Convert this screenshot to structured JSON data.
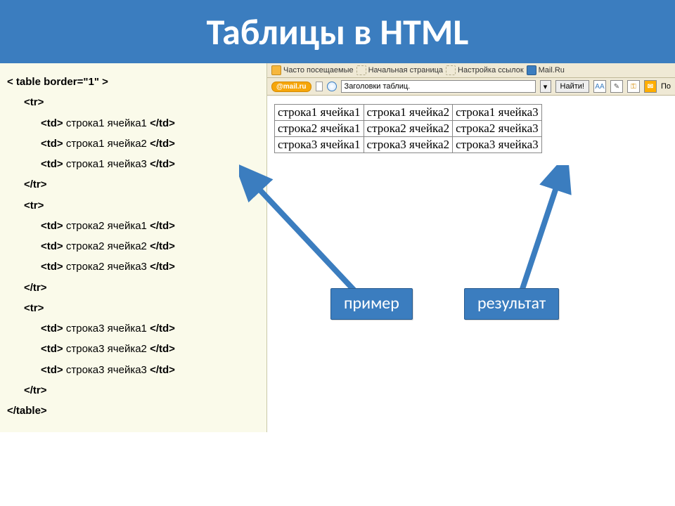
{
  "title": "Таблицы в HTML",
  "code": {
    "open_table": "< table border=\"1\" >",
    "tr_open": "<tr>",
    "tr_close": "</tr>",
    "close_table": "</table>",
    "cells": {
      "r1c1": "<td> строка1 ячейка1 </td>",
      "r1c2": "<td> строка1 ячейка2 </td>",
      "r1c3": "<td> строка1 ячейка3 </td>",
      "r2c1": "<td> строка2 ячейка1 </td>",
      "r2c2": "<td> строка2 ячейка2 </td>",
      "r2c3": "<td> строка2 ячейка3 </td>",
      "r3c1": "<td> строка3 ячейка1 </td>",
      "r3c2": "<td> строка3 ячейка2 </td>",
      "r3c3": "<td> строка3 ячейка3 </td>"
    }
  },
  "browser_links": {
    "frequent": "Часто посещаемые",
    "home": "Начальная страница",
    "links_setup": "Настройка ссылок",
    "mailru": "Mail.Ru"
  },
  "search": {
    "logo": "@mail.ru",
    "query": "Заголовки таблиц.",
    "find": "Найти!",
    "aa": "AA",
    "po": "По"
  },
  "result_cells": {
    "r1c1": "строка1 ячейка1",
    "r1c2": "строка1 ячейка2",
    "r1c3": "строка1 ячейка3",
    "r2c1": "строка2 ячейка1",
    "r2c2": "строка2 ячейка2",
    "r2c3": "строка2 ячейка3",
    "r3c1": "строка3 ячейка1",
    "r3c2": "строка3 ячейка2",
    "r3c3": "строка3 ячейка3"
  },
  "callouts": {
    "example": "пример",
    "result": "результат"
  }
}
